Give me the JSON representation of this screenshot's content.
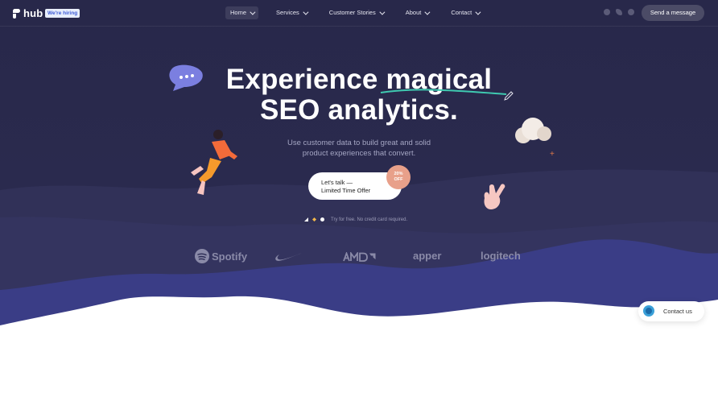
{
  "nav": {
    "logo": "hub",
    "hiring_badge": "We're hiring",
    "menu": [
      {
        "label": "Home",
        "active": true
      },
      {
        "label": "Services",
        "active": false
      },
      {
        "label": "Customer Stories",
        "active": false
      },
      {
        "label": "About",
        "active": false
      },
      {
        "label": "Contact",
        "active": false
      }
    ],
    "socials": [
      "dribbble-icon",
      "twitter-icon",
      "github-icon"
    ],
    "send_message": "Send a message"
  },
  "hero": {
    "headline_line1_a": "Experience",
    "headline_line1_b": "magical",
    "headline_line2": "SEO analytics.",
    "subtitle_line1": "Use customer data to build great and solid",
    "subtitle_line2": "product experiences that convert.",
    "cta_line1": "Let's talk —",
    "cta_line2": "Limited Time Offer",
    "discount_line1": "20%",
    "discount_line2": "OFF",
    "trial_note": "Try for free. No credit card required."
  },
  "brands": [
    "Spotify",
    "apper",
    "logitech"
  ],
  "brand_logos": [
    "spotify-logo",
    "nike-logo",
    "amd-logo"
  ],
  "contact_bubble": "Contact us",
  "colors": {
    "bg": "#28284a",
    "wave": "#343462",
    "wave_blue": "#3b3e8a",
    "accent_teal": "#3fc9b0",
    "badge": "#e8a08a"
  }
}
